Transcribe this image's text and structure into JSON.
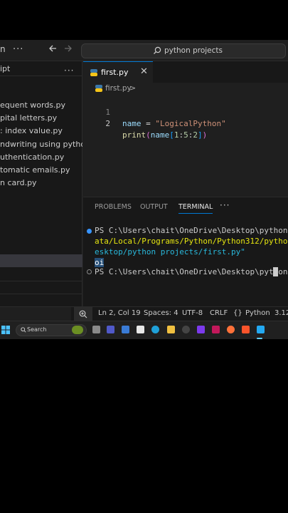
{
  "title_bar": {
    "search_label": "python projects"
  },
  "sidebar": {
    "partial_top": "ipts",
    "files": [
      "equent words.py",
      "pital letters.py",
      ": index value.py",
      "ndwriting using python....",
      "uthentication.py",
      "tomatic emails.py",
      "n card.py"
    ]
  },
  "editor": {
    "tab_label": "first.py",
    "breadcrumb_file": "first.py",
    "breadcrumb_sep": ">",
    "lines": [
      {
        "num": "1",
        "t1": "name",
        "t2": " = ",
        "t3": "\"LogicalPython\""
      },
      {
        "num": "2",
        "t1": "print",
        "t2": "(",
        "t3": "name",
        "t4": "[",
        "t5": "1",
        "t6": ":",
        "t7": "5",
        "t8": ":",
        "t9": "2",
        "t10": "]",
        "t11": ")"
      }
    ]
  },
  "panel": {
    "tabs": [
      "PROBLEMS",
      "OUTPUT",
      "TERMINAL"
    ],
    "active_tab": "TERMINAL",
    "more": "···",
    "terminal": {
      "line1": "PS C:\\Users\\chait\\OneDrive\\Desktop\\python pro",
      "line2": "ata/Local/Programs/Python/Python312/python.e",
      "line3": "esktop/python projects/first.py\"",
      "output": "oi",
      "line5": "PS C:\\Users\\chait\\OneDrive\\Desktop\\python pro"
    }
  },
  "status_bar": {
    "position": "Ln 2, Col 19",
    "spaces": "Spaces: 4",
    "encoding": "UTF-8",
    "eol": "CRLF",
    "language": "Python",
    "version": "3.12"
  },
  "taskbar": {
    "search_label": "Search"
  },
  "colors": {
    "accent": "#0078d4",
    "editor_bg": "#1f1f1f",
    "sidebar_bg": "#181818",
    "string": "#ce9178",
    "variable": "#9cdcfe"
  }
}
